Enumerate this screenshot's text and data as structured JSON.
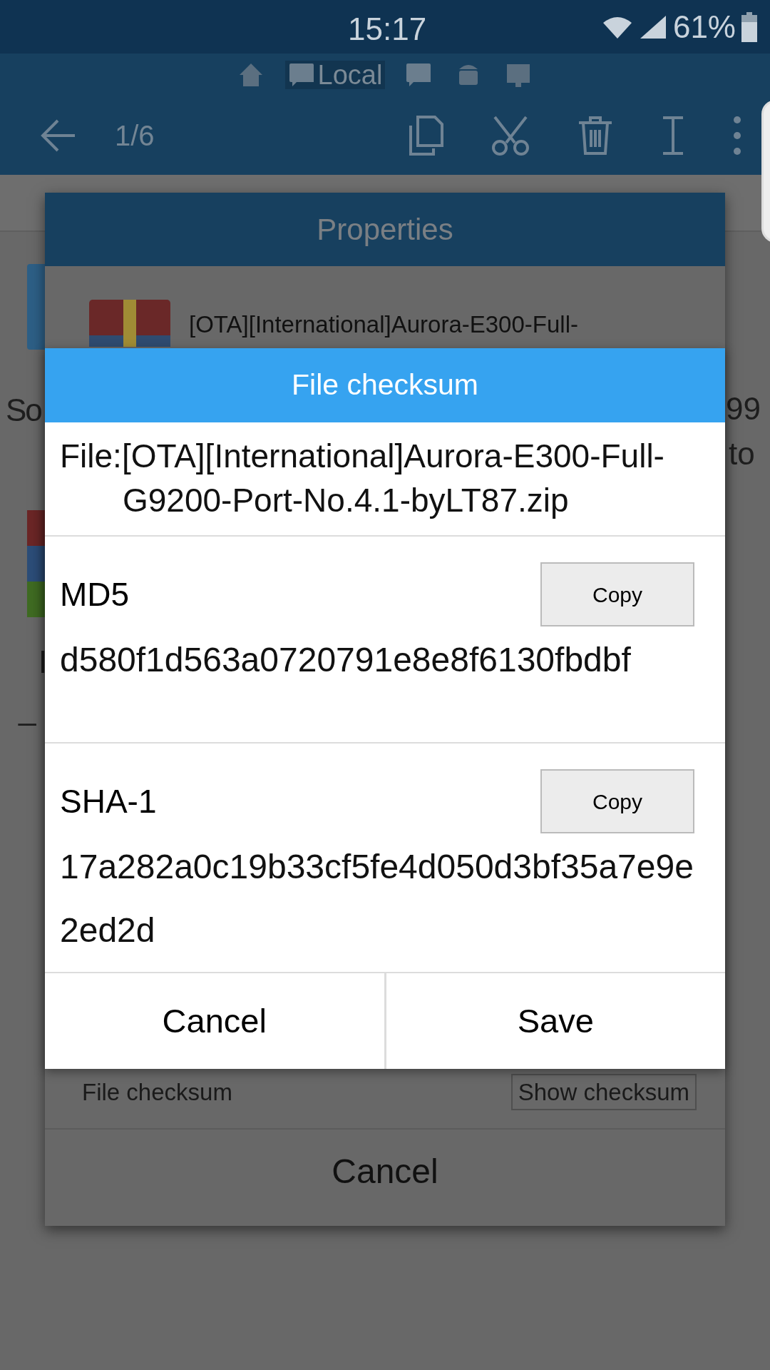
{
  "status_bar": {
    "time": "15:17",
    "battery": "61%"
  },
  "location_bar": {
    "items": [
      {
        "kind": "home",
        "selected": false
      },
      {
        "kind": "sd",
        "label": "Local",
        "selected": true
      },
      {
        "kind": "sd",
        "selected": false
      },
      {
        "kind": "android",
        "selected": false
      },
      {
        "kind": "remote",
        "selected": false
      }
    ]
  },
  "toolbar": {
    "counter": "1/6"
  },
  "background_fragments": [
    "So",
    "99",
    "to",
    "I",
    "_"
  ],
  "properties_dialog": {
    "title": "Properties",
    "file_name": "[OTA][International]Aurora-E300-Full-",
    "checksum_label": "File checksum",
    "show_button": "Show checksum",
    "cancel": "Cancel"
  },
  "checksum_dialog": {
    "title": "File checksum",
    "file_label": "File:",
    "file_name": "[OTA][International]Aurora-E300-Full-G9200-Port-No.4.1-byLT87.zip",
    "hashes": [
      {
        "name": "MD5",
        "value": "d580f1d563a0720791e8e8f6130fbdbf",
        "copy": "Copy"
      },
      {
        "name": "SHA-1",
        "value": "17a282a0c19b33cf5fe4d050d3bf35a7e9e2ed2d",
        "copy": "Copy"
      }
    ],
    "buttons": [
      "Cancel",
      "Save"
    ]
  }
}
